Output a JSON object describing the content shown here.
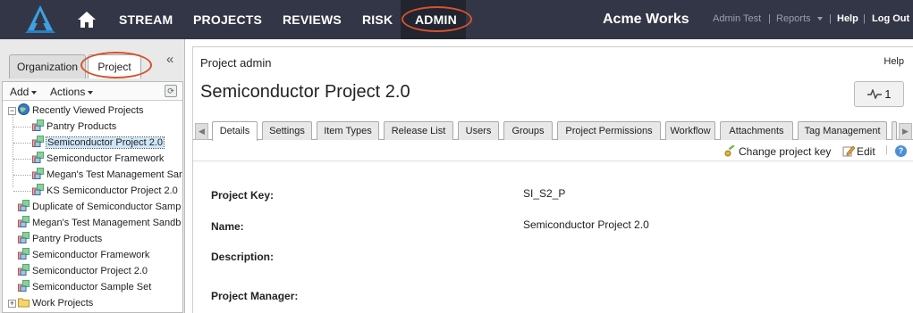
{
  "nav": {
    "items": [
      "STREAM",
      "PROJECTS",
      "REVIEWS",
      "RISK",
      "ADMIN"
    ],
    "brand": "Acme Works",
    "user": "Admin Test",
    "reports": "Reports",
    "sep": "|",
    "help": "Help",
    "logout": "Log Out"
  },
  "sidebar": {
    "tabs": [
      "Organization",
      "Project"
    ],
    "collapse": "«",
    "add": "Add",
    "actions": "Actions",
    "tree": [
      {
        "label": "Recently Viewed Projects",
        "level": 0,
        "icon": "globe-icon",
        "expander": "−"
      },
      {
        "label": "Pantry Products",
        "level": 1,
        "icon": "project-icon"
      },
      {
        "label": "Semiconductor Project 2.0",
        "level": 1,
        "icon": "project-icon",
        "selected": true
      },
      {
        "label": "Semiconductor Framework",
        "level": 1,
        "icon": "project-icon"
      },
      {
        "label": "Megan's Test Management Sar",
        "level": 1,
        "icon": "project-icon"
      },
      {
        "label": "KS Semiconductor Project 2.0",
        "level": 1,
        "icon": "project-icon"
      },
      {
        "label": "Duplicate of Semiconductor Samp",
        "level": 0,
        "icon": "project-icon"
      },
      {
        "label": "Megan's Test Management Sandb",
        "level": 0,
        "icon": "project-icon"
      },
      {
        "label": "Pantry Products",
        "level": 0,
        "icon": "project-icon"
      },
      {
        "label": "Semiconductor Framework",
        "level": 0,
        "icon": "project-icon"
      },
      {
        "label": "Semiconductor Project 2.0",
        "level": 0,
        "icon": "project-icon"
      },
      {
        "label": "Semiconductor Sample Set",
        "level": 0,
        "icon": "project-icon"
      },
      {
        "label": "Work Projects",
        "level": 0,
        "icon": "folder-icon",
        "expander": "+"
      }
    ]
  },
  "main": {
    "breadcrumb": "Project admin",
    "help": "Help",
    "title": "Semiconductor Project 2.0",
    "activity_count": "1",
    "tabs": [
      "Details",
      "Settings",
      "Item Types",
      "Release List",
      "Users",
      "Groups",
      "Project Permissions",
      "Workflow",
      "Attachments",
      "Tag Management"
    ],
    "actions": {
      "change_key": "Change project key",
      "edit": "Edit",
      "help": "?"
    },
    "fields": [
      {
        "label": "Project Key:",
        "value": "SI_S2_P"
      },
      {
        "label": "Name:",
        "value": "Semiconductor Project 2.0"
      },
      {
        "label": "Description:",
        "value": ""
      },
      {
        "label": "Project Manager:",
        "value": ""
      }
    ]
  },
  "colors": {
    "topbar": "#333646",
    "accent_ring": "#d4542c",
    "selected_row": "#cfe6f8"
  }
}
